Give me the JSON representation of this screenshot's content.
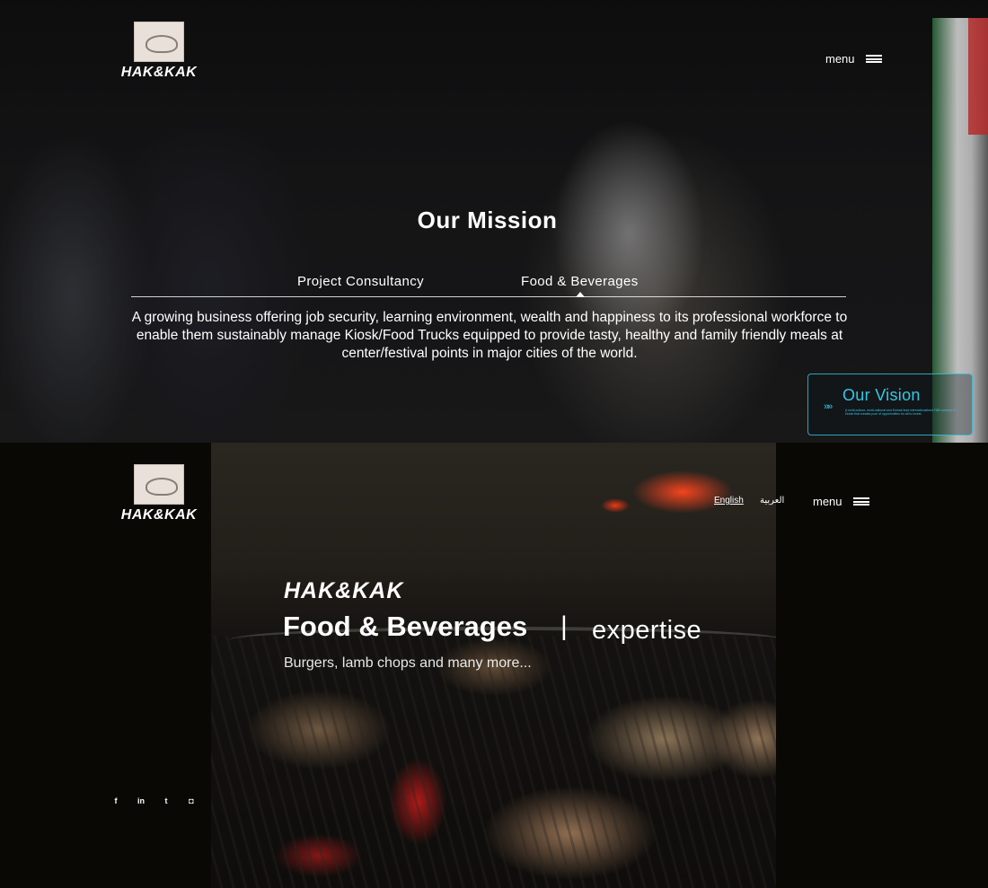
{
  "top": {
    "logo": {
      "wordmark": "HAK&KAK"
    },
    "menu": {
      "label": "menu"
    },
    "mission": {
      "title": "Our Mission",
      "tabs": [
        {
          "label": "Project Consultancy"
        },
        {
          "label": "Food & Beverages"
        }
      ],
      "text": "A growing business offering job security, learning environment, wealth and happiness to its professional workforce to enable them sustainably manage Kiosk/Food Trucks equipped to provide tasty, healthy and family friendly meals at center/festival points in major cities of the world."
    },
    "vision": {
      "title": "Our Vision",
      "subtitle": "A multi-culture, multi-national and Emirati lead internationalized F&B concept of Dubai that creates pool of opportunities for all to invest"
    }
  },
  "bottom": {
    "logo": {
      "wordmark": "HAK&KAK"
    },
    "lang": {
      "english": "English",
      "arabic": "العربية"
    },
    "menu": {
      "label": "menu"
    },
    "hero": {
      "brand": "HAK&KAK",
      "title": "Food & Beverages",
      "separator": "|",
      "tag": "expertise",
      "subtitle": "Burgers, lamb chops and many more..."
    },
    "social": [
      {
        "icon": "facebook-icon",
        "glyph": "f"
      },
      {
        "icon": "linkedin-icon",
        "glyph": "in"
      },
      {
        "icon": "twitter-icon",
        "glyph": "t"
      },
      {
        "icon": "instagram-icon",
        "glyph": "◘"
      }
    ]
  },
  "colors": {
    "accent": "#36c6e6",
    "background": "#0a0805",
    "text": "#ffffff"
  }
}
